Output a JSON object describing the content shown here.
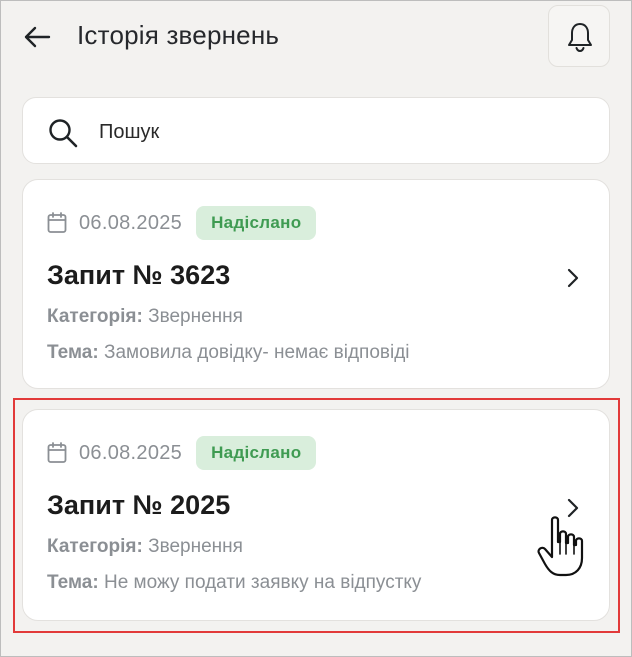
{
  "header": {
    "title": "Історія звернень",
    "back_icon": "arrow-left-icon",
    "bell_icon": "bell-icon"
  },
  "search": {
    "placeholder": "Пошук",
    "value": "",
    "icon": "search-icon"
  },
  "requests": [
    {
      "date": "06.08.2025",
      "status": "Надіслано",
      "title": "Запит № 3623",
      "category_label": "Категорія:",
      "category": "Звернення",
      "theme_label": "Тема:",
      "theme": "Замовила довідку- немає відповіді"
    },
    {
      "date": "06.08.2025",
      "status": "Надіслано",
      "title": "Запит № 2025",
      "category_label": "Категорія:",
      "category": "Звернення",
      "theme_label": "Тема:",
      "theme": "Не можу подати заявку на відпустку"
    }
  ],
  "colors": {
    "status_bg": "#d9eedc",
    "status_text": "#3f9b52",
    "highlight": "#e23a3a",
    "background": "#f3f2f0"
  }
}
